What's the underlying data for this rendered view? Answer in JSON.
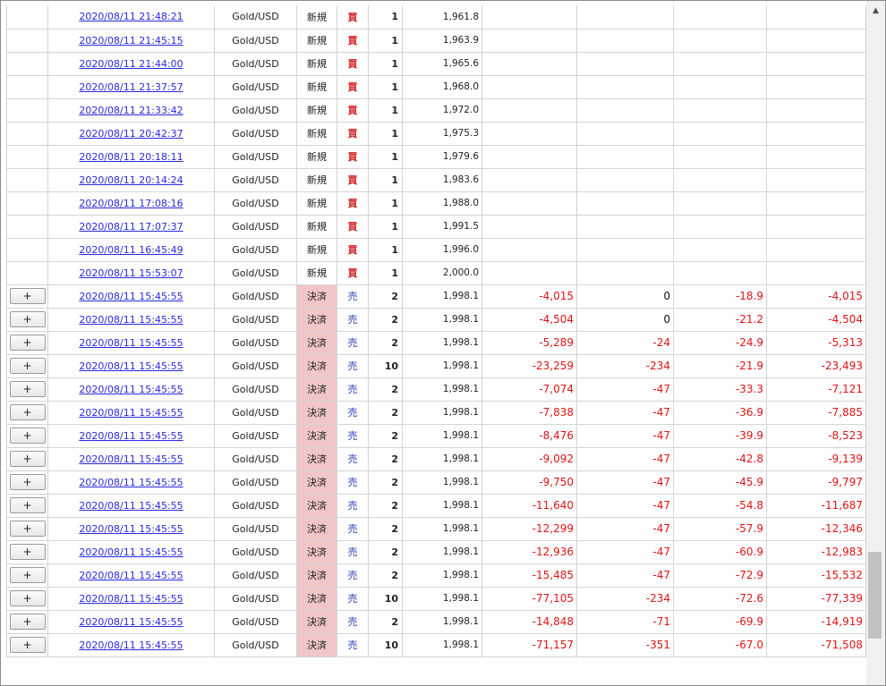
{
  "buttons": {
    "expand_label": "+"
  },
  "icons": {
    "scroll_up": "scroll-up-arrow-icon"
  },
  "colors": {
    "negative": "#e01414",
    "buy": "#d21f1f",
    "sell": "#2a3fb3",
    "settle_bg": "#f1c6c6",
    "link": "#2a2adf"
  },
  "scroll": {
    "position_fraction": 0.92,
    "visible_fraction": 0.13
  },
  "rows": [
    {
      "expand": false,
      "date": "2020/08/11 21:48:21",
      "symbol": "Gold/USD",
      "type": "新規",
      "side": "買",
      "qty": "1",
      "price": "1,961.8",
      "c1": "",
      "c2": "",
      "c3": "",
      "c4": ""
    },
    {
      "expand": false,
      "date": "2020/08/11 21:45:15",
      "symbol": "Gold/USD",
      "type": "新規",
      "side": "買",
      "qty": "1",
      "price": "1,963.9",
      "c1": "",
      "c2": "",
      "c3": "",
      "c4": ""
    },
    {
      "expand": false,
      "date": "2020/08/11 21:44:00",
      "symbol": "Gold/USD",
      "type": "新規",
      "side": "買",
      "qty": "1",
      "price": "1,965.6",
      "c1": "",
      "c2": "",
      "c3": "",
      "c4": ""
    },
    {
      "expand": false,
      "date": "2020/08/11 21:37:57",
      "symbol": "Gold/USD",
      "type": "新規",
      "side": "買",
      "qty": "1",
      "price": "1,968.0",
      "c1": "",
      "c2": "",
      "c3": "",
      "c4": ""
    },
    {
      "expand": false,
      "date": "2020/08/11 21:33:42",
      "symbol": "Gold/USD",
      "type": "新規",
      "side": "買",
      "qty": "1",
      "price": "1,972.0",
      "c1": "",
      "c2": "",
      "c3": "",
      "c4": ""
    },
    {
      "expand": false,
      "date": "2020/08/11 20:42:37",
      "symbol": "Gold/USD",
      "type": "新規",
      "side": "買",
      "qty": "1",
      "price": "1,975.3",
      "c1": "",
      "c2": "",
      "c3": "",
      "c4": ""
    },
    {
      "expand": false,
      "date": "2020/08/11 20:18:11",
      "symbol": "Gold/USD",
      "type": "新規",
      "side": "買",
      "qty": "1",
      "price": "1,979.6",
      "c1": "",
      "c2": "",
      "c3": "",
      "c4": ""
    },
    {
      "expand": false,
      "date": "2020/08/11 20:14:24",
      "symbol": "Gold/USD",
      "type": "新規",
      "side": "買",
      "qty": "1",
      "price": "1,983.6",
      "c1": "",
      "c2": "",
      "c3": "",
      "c4": ""
    },
    {
      "expand": false,
      "date": "2020/08/11 17:08:16",
      "symbol": "Gold/USD",
      "type": "新規",
      "side": "買",
      "qty": "1",
      "price": "1,988.0",
      "c1": "",
      "c2": "",
      "c3": "",
      "c4": ""
    },
    {
      "expand": false,
      "date": "2020/08/11 17:07:37",
      "symbol": "Gold/USD",
      "type": "新規",
      "side": "買",
      "qty": "1",
      "price": "1,991.5",
      "c1": "",
      "c2": "",
      "c3": "",
      "c4": ""
    },
    {
      "expand": false,
      "date": "2020/08/11 16:45:49",
      "symbol": "Gold/USD",
      "type": "新規",
      "side": "買",
      "qty": "1",
      "price": "1,996.0",
      "c1": "",
      "c2": "",
      "c3": "",
      "c4": ""
    },
    {
      "expand": false,
      "date": "2020/08/11 15:53:07",
      "symbol": "Gold/USD",
      "type": "新規",
      "side": "買",
      "qty": "1",
      "price": "2,000.0",
      "c1": "",
      "c2": "",
      "c3": "",
      "c4": ""
    },
    {
      "expand": true,
      "date": "2020/08/11 15:45:55",
      "symbol": "Gold/USD",
      "type": "決済",
      "side": "売",
      "qty": "2",
      "price": "1,998.1",
      "c1": "-4,015",
      "c2": "0",
      "c3": "-18.9",
      "c4": "-4,015"
    },
    {
      "expand": true,
      "date": "2020/08/11 15:45:55",
      "symbol": "Gold/USD",
      "type": "決済",
      "side": "売",
      "qty": "2",
      "price": "1,998.1",
      "c1": "-4,504",
      "c2": "0",
      "c3": "-21.2",
      "c4": "-4,504"
    },
    {
      "expand": true,
      "date": "2020/08/11 15:45:55",
      "symbol": "Gold/USD",
      "type": "決済",
      "side": "売",
      "qty": "2",
      "price": "1,998.1",
      "c1": "-5,289",
      "c2": "-24",
      "c3": "-24.9",
      "c4": "-5,313"
    },
    {
      "expand": true,
      "date": "2020/08/11 15:45:55",
      "symbol": "Gold/USD",
      "type": "決済",
      "side": "売",
      "qty": "10",
      "price": "1,998.1",
      "c1": "-23,259",
      "c2": "-234",
      "c3": "-21.9",
      "c4": "-23,493"
    },
    {
      "expand": true,
      "date": "2020/08/11 15:45:55",
      "symbol": "Gold/USD",
      "type": "決済",
      "side": "売",
      "qty": "2",
      "price": "1,998.1",
      "c1": "-7,074",
      "c2": "-47",
      "c3": "-33.3",
      "c4": "-7,121"
    },
    {
      "expand": true,
      "date": "2020/08/11 15:45:55",
      "symbol": "Gold/USD",
      "type": "決済",
      "side": "売",
      "qty": "2",
      "price": "1,998.1",
      "c1": "-7,838",
      "c2": "-47",
      "c3": "-36.9",
      "c4": "-7,885"
    },
    {
      "expand": true,
      "date": "2020/08/11 15:45:55",
      "symbol": "Gold/USD",
      "type": "決済",
      "side": "売",
      "qty": "2",
      "price": "1,998.1",
      "c1": "-8,476",
      "c2": "-47",
      "c3": "-39.9",
      "c4": "-8,523"
    },
    {
      "expand": true,
      "date": "2020/08/11 15:45:55",
      "symbol": "Gold/USD",
      "type": "決済",
      "side": "売",
      "qty": "2",
      "price": "1,998.1",
      "c1": "-9,092",
      "c2": "-47",
      "c3": "-42.8",
      "c4": "-9,139"
    },
    {
      "expand": true,
      "date": "2020/08/11 15:45:55",
      "symbol": "Gold/USD",
      "type": "決済",
      "side": "売",
      "qty": "2",
      "price": "1,998.1",
      "c1": "-9,750",
      "c2": "-47",
      "c3": "-45.9",
      "c4": "-9,797"
    },
    {
      "expand": true,
      "date": "2020/08/11 15:45:55",
      "symbol": "Gold/USD",
      "type": "決済",
      "side": "売",
      "qty": "2",
      "price": "1,998.1",
      "c1": "-11,640",
      "c2": "-47",
      "c3": "-54.8",
      "c4": "-11,687"
    },
    {
      "expand": true,
      "date": "2020/08/11 15:45:55",
      "symbol": "Gold/USD",
      "type": "決済",
      "side": "売",
      "qty": "2",
      "price": "1,998.1",
      "c1": "-12,299",
      "c2": "-47",
      "c3": "-57.9",
      "c4": "-12,346"
    },
    {
      "expand": true,
      "date": "2020/08/11 15:45:55",
      "symbol": "Gold/USD",
      "type": "決済",
      "side": "売",
      "qty": "2",
      "price": "1,998.1",
      "c1": "-12,936",
      "c2": "-47",
      "c3": "-60.9",
      "c4": "-12,983"
    },
    {
      "expand": true,
      "date": "2020/08/11 15:45:55",
      "symbol": "Gold/USD",
      "type": "決済",
      "side": "売",
      "qty": "2",
      "price": "1,998.1",
      "c1": "-15,485",
      "c2": "-47",
      "c3": "-72.9",
      "c4": "-15,532"
    },
    {
      "expand": true,
      "date": "2020/08/11 15:45:55",
      "symbol": "Gold/USD",
      "type": "決済",
      "side": "売",
      "qty": "10",
      "price": "1,998.1",
      "c1": "-77,105",
      "c2": "-234",
      "c3": "-72.6",
      "c4": "-77,339"
    },
    {
      "expand": true,
      "date": "2020/08/11 15:45:55",
      "symbol": "Gold/USD",
      "type": "決済",
      "side": "売",
      "qty": "2",
      "price": "1,998.1",
      "c1": "-14,848",
      "c2": "-71",
      "c3": "-69.9",
      "c4": "-14,919"
    },
    {
      "expand": true,
      "date": "2020/08/11 15:45:55",
      "symbol": "Gold/USD",
      "type": "決済",
      "side": "売",
      "qty": "10",
      "price": "1,998.1",
      "c1": "-71,157",
      "c2": "-351",
      "c3": "-67.0",
      "c4": "-71,508"
    }
  ]
}
